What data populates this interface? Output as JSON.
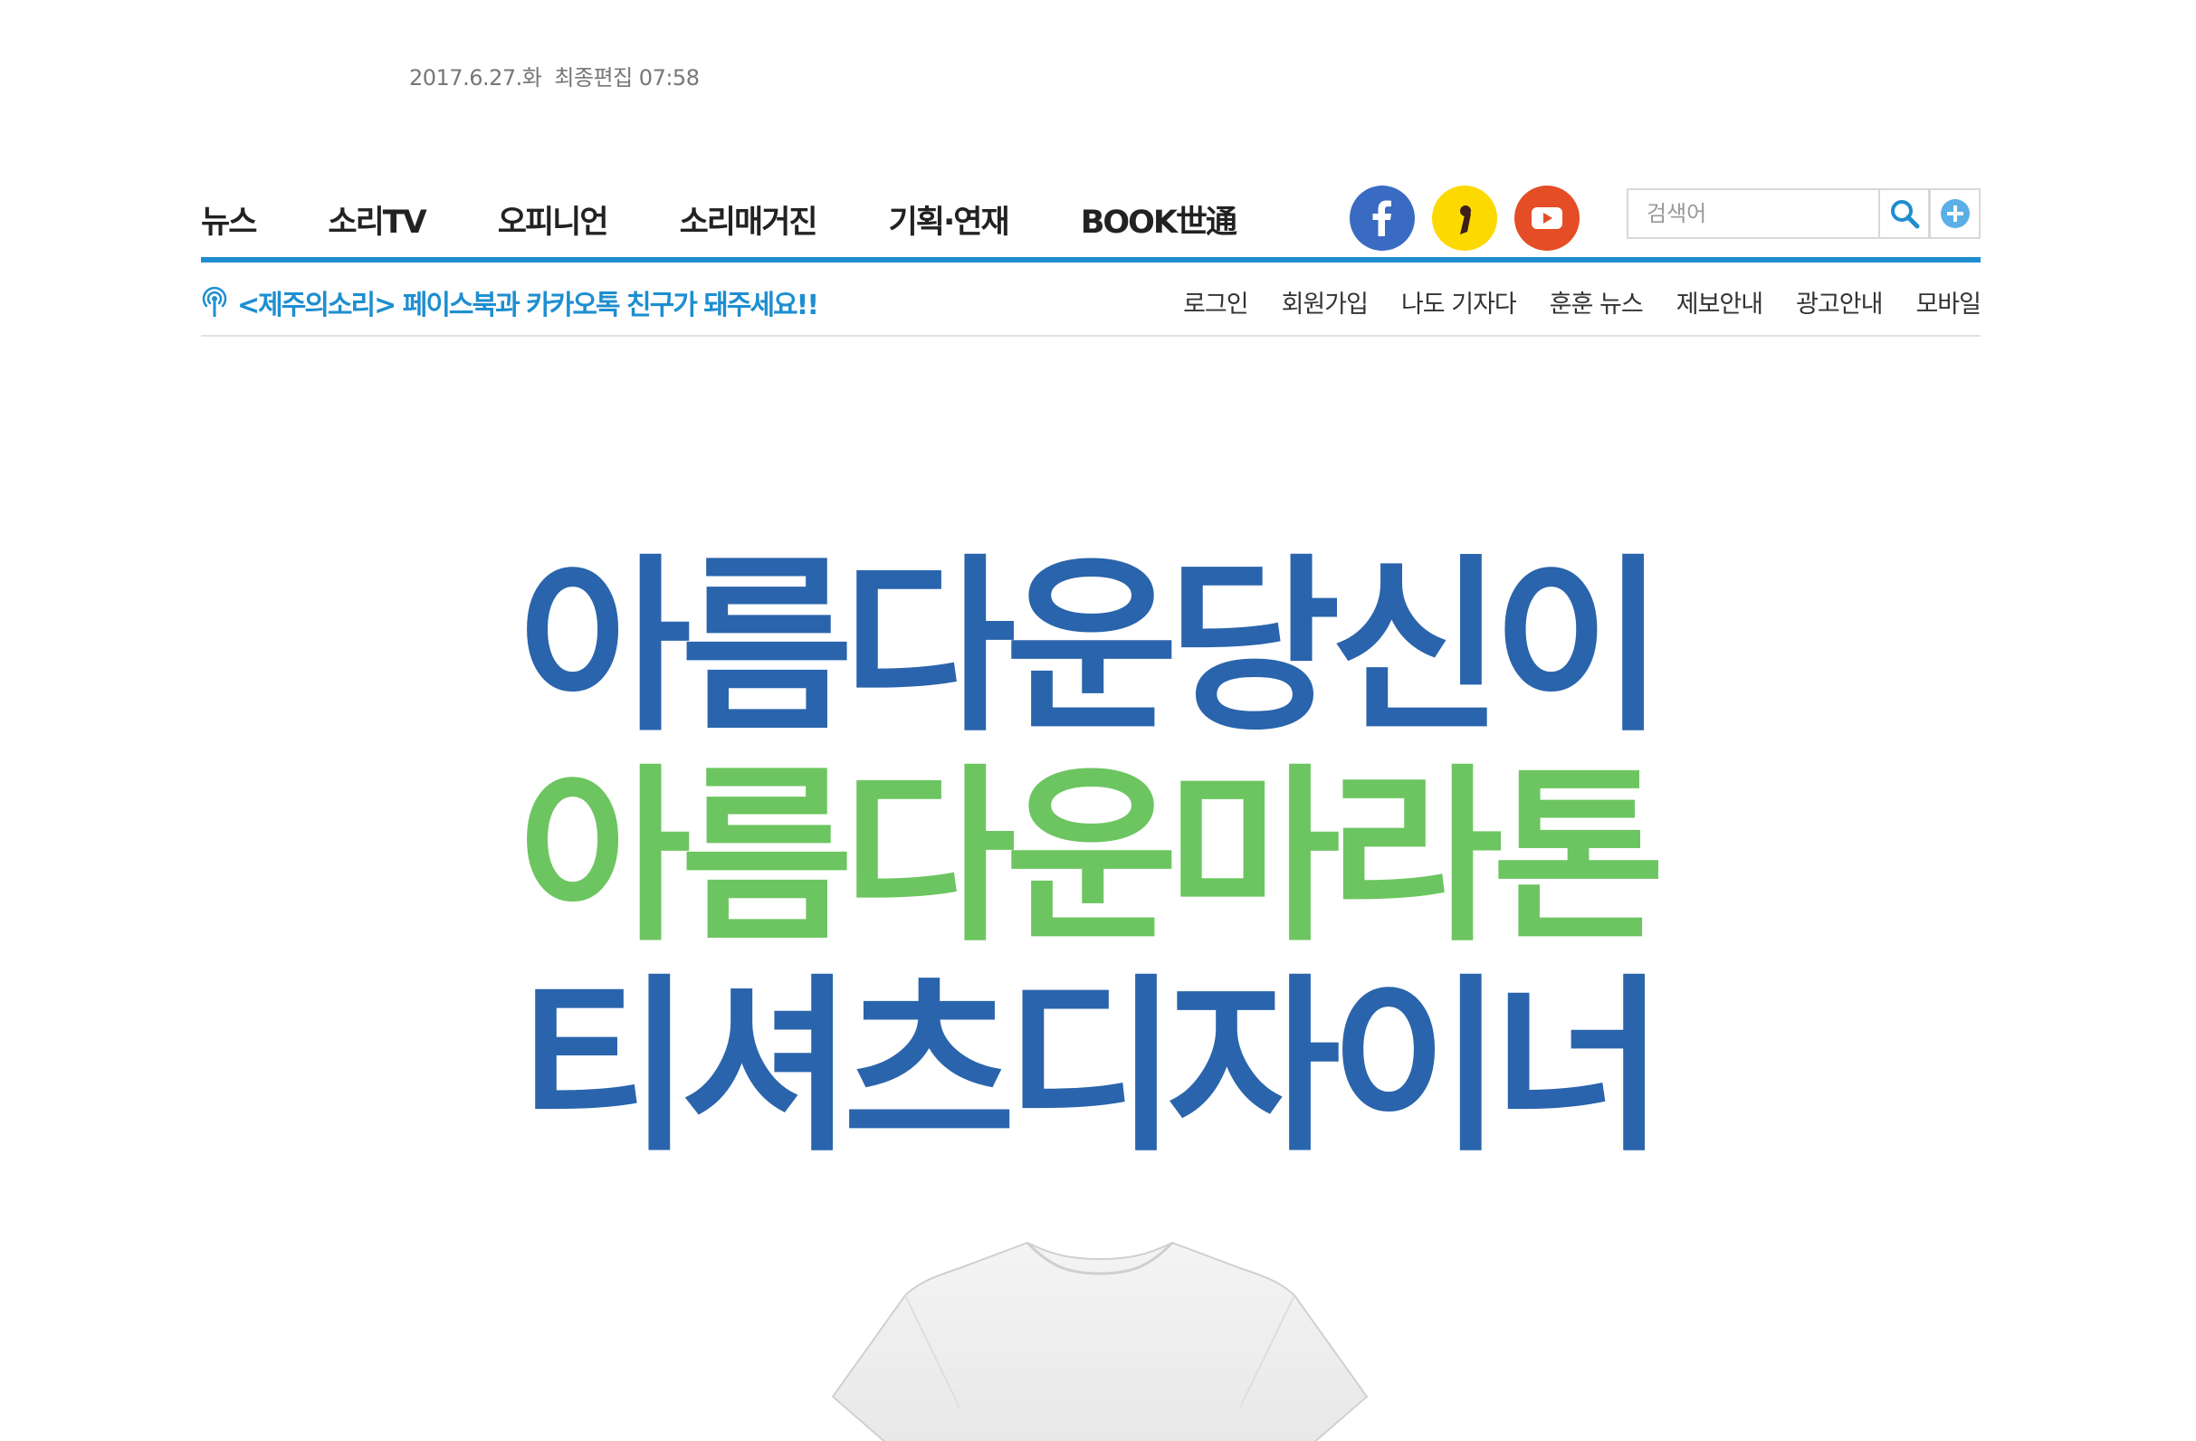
{
  "header": {
    "date": "2017.6.27.화",
    "last_edit": "최종편집 07:58"
  },
  "nav": {
    "items": [
      {
        "label": "뉴스"
      },
      {
        "label": "소리TV"
      },
      {
        "label": "오피니언"
      },
      {
        "label": "소리매거진"
      },
      {
        "label": "기획·연재"
      },
      {
        "label": "BOOK世通"
      }
    ]
  },
  "sns": {
    "facebook_icon": "facebook-icon",
    "kakao_icon": "kakaostory-icon",
    "youtube_icon": "youtube-icon",
    "colors": {
      "facebook": "#3a6bc2",
      "kakao": "#fcd900",
      "youtube": "#e44d26"
    }
  },
  "search": {
    "placeholder": "검색어",
    "value": "",
    "search_icon": "search-icon",
    "plus_icon": "plus-circle-icon"
  },
  "notice": {
    "icon": "broadcast-icon",
    "text": "<제주의소리> 페이스북과 카카오톡 친구가 돼주세요!!"
  },
  "util_menu": [
    {
      "label": "로그인"
    },
    {
      "label": "회원가입"
    },
    {
      "label": "나도 기자다"
    },
    {
      "label": "훈훈 뉴스"
    },
    {
      "label": "제보안내"
    },
    {
      "label": "광고안내"
    },
    {
      "label": "모바일"
    }
  ],
  "banner": {
    "line1": "아름다운당신이",
    "line2": "아름다운마라톤",
    "line3": "티셔츠디자이너",
    "image": "white-tshirt-image",
    "colors": {
      "blue": "#2a64ac",
      "green": "#6cc560"
    }
  },
  "theme": {
    "accent": "#1e8ed0",
    "divider": "#e1e1e1"
  }
}
